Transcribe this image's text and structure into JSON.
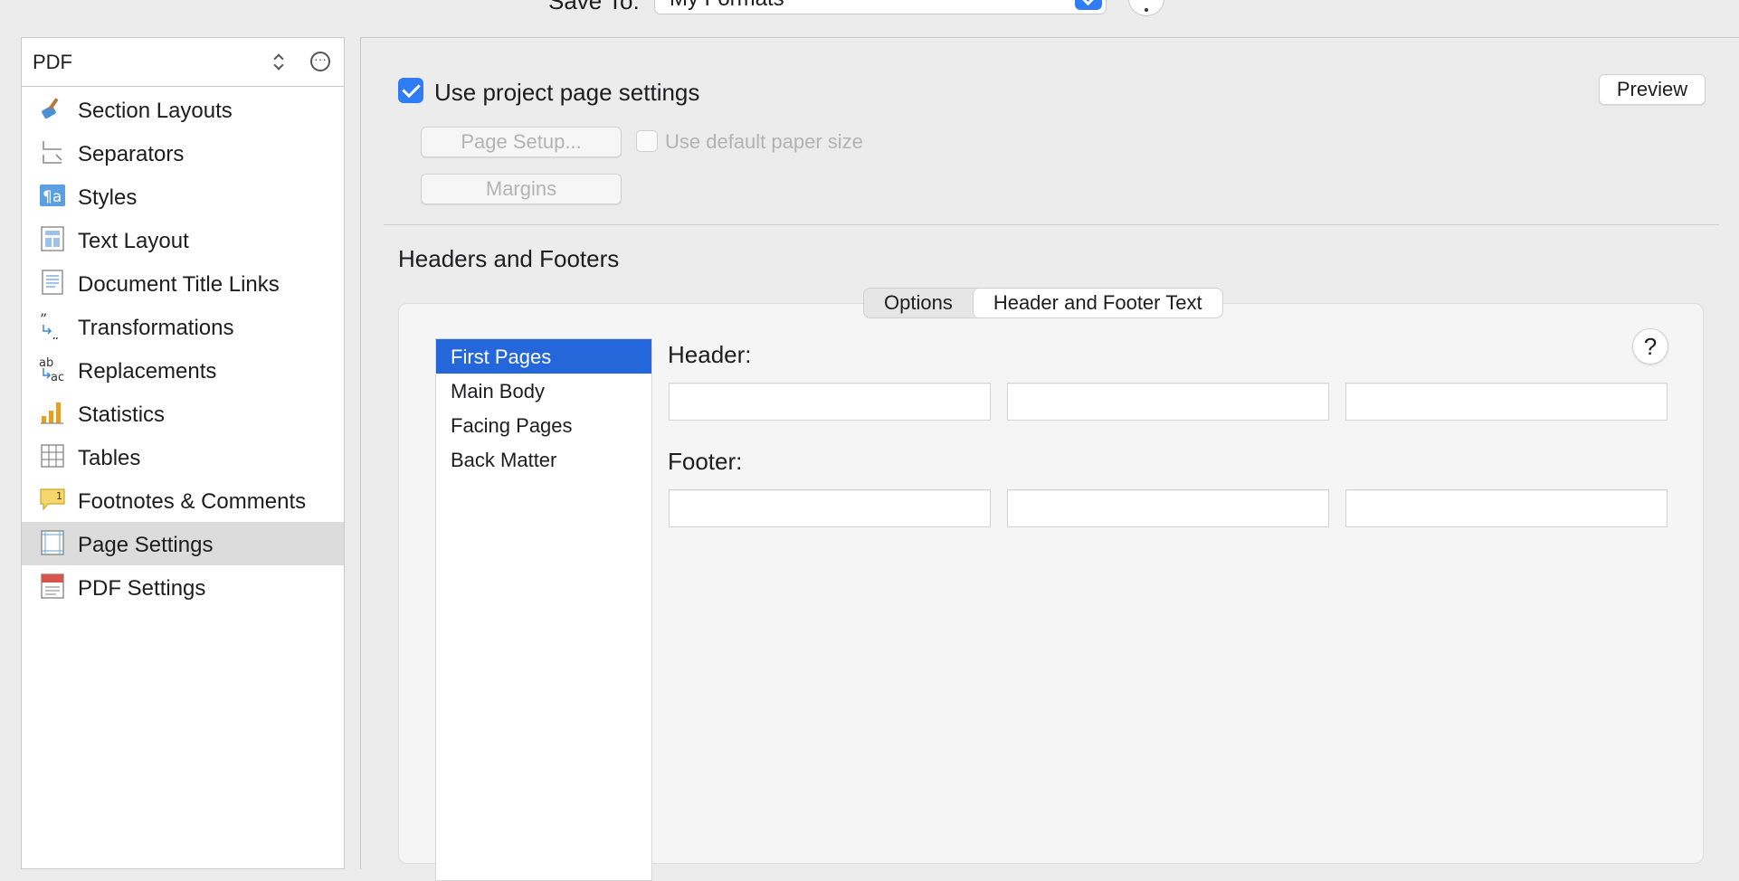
{
  "top": {
    "save_to_label": "Save To:",
    "save_to_value": "My Formats"
  },
  "sidebar": {
    "format": "PDF",
    "items": [
      {
        "label": "Section Layouts",
        "icon": "paintbrush-icon"
      },
      {
        "label": "Separators",
        "icon": "separator-icon"
      },
      {
        "label": "Styles",
        "icon": "styles-icon"
      },
      {
        "label": "Text Layout",
        "icon": "text-layout-icon"
      },
      {
        "label": "Document Title Links",
        "icon": "document-lines-icon"
      },
      {
        "label": "Transformations",
        "icon": "quotes-icon"
      },
      {
        "label": "Replacements",
        "icon": "replace-icon"
      },
      {
        "label": "Statistics",
        "icon": "bar-chart-icon"
      },
      {
        "label": "Tables",
        "icon": "table-icon"
      },
      {
        "label": "Footnotes & Comments",
        "icon": "footnote-icon"
      },
      {
        "label": "Page Settings",
        "icon": "page-settings-icon"
      },
      {
        "label": "PDF Settings",
        "icon": "pdf-icon"
      }
    ],
    "selected": "Page Settings"
  },
  "main": {
    "use_project_page_settings": "Use project page settings",
    "use_project_checked": true,
    "preview": "Preview",
    "page_setup": "Page Setup...",
    "use_default_paper_size": "Use default paper size",
    "margins": "Margins",
    "headers_footers_title": "Headers and Footers",
    "tabs": [
      {
        "label": "Options",
        "active": false
      },
      {
        "label": "Header and Footer Text",
        "active": true
      }
    ],
    "page_types": [
      "First Pages",
      "Main Body",
      "Facing Pages",
      "Back Matter"
    ],
    "selected_page_type": "First Pages",
    "help": "?",
    "header_label": "Header:",
    "footer_label": "Footer:"
  },
  "colors": {
    "accent": "#2f7cf6",
    "selection": "#2467db"
  }
}
